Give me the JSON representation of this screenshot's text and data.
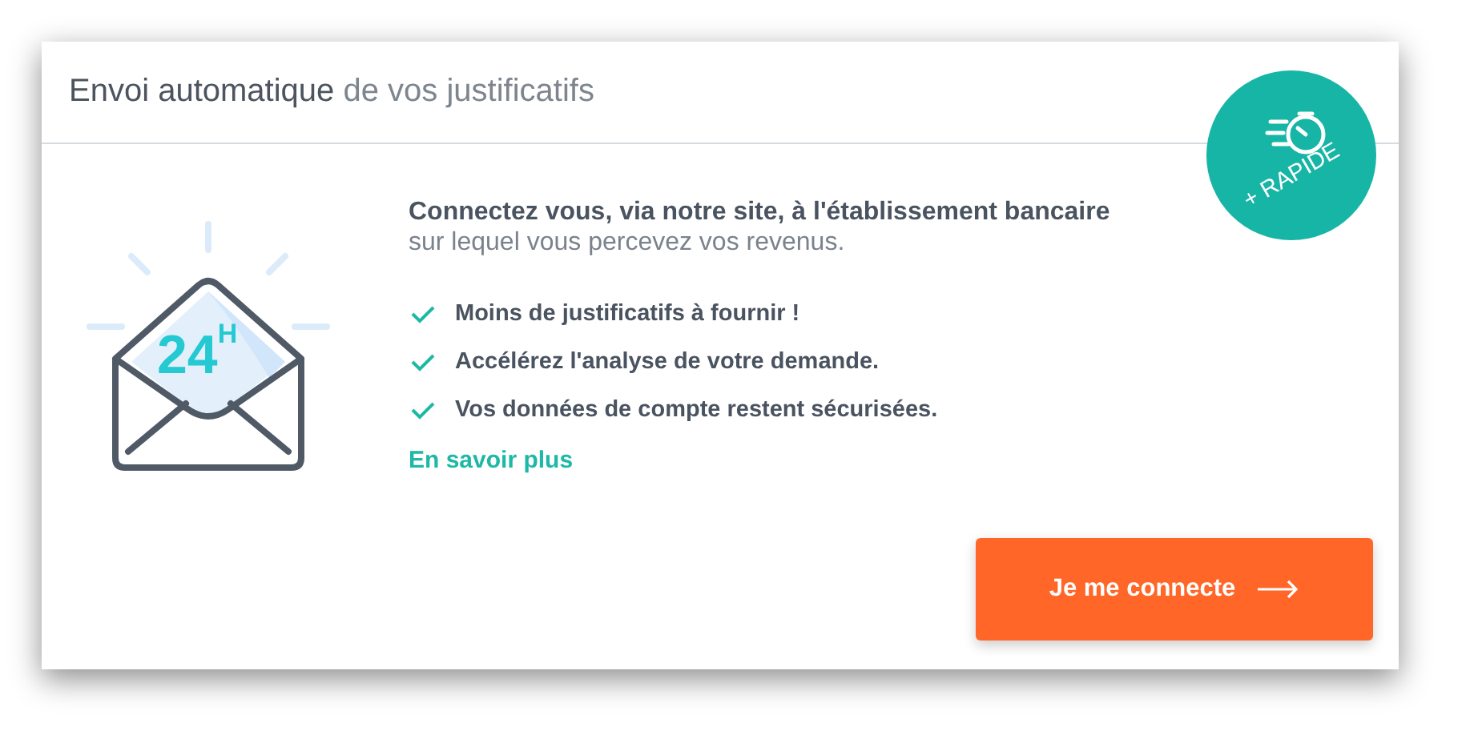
{
  "card": {
    "title": "**Envoi automatique** de vos justificatifs",
    "badge": {
      "label": "+ RAPIDE"
    },
    "illustration": {
      "label": "24$^{H}$"
    },
    "intro": {
      "headline": "Connectez vous, via notre site, à l'établissement bancaire",
      "text": "sur lequel vous percevez vos revenus."
    },
    "benefits": [
      {
        "text": "Moins de justificatifs à fournir !",
        "checked": true
      },
      {
        "text": "Accélérez l'analyse de votre demande.",
        "checked": true
      },
      {
        "text": "Vos données de compte restent sécurisées.",
        "checked": true
      }
    ],
    "link": "En savoir plus",
    "button": {
      "label": "Je me connecte"
    }
  }
}
